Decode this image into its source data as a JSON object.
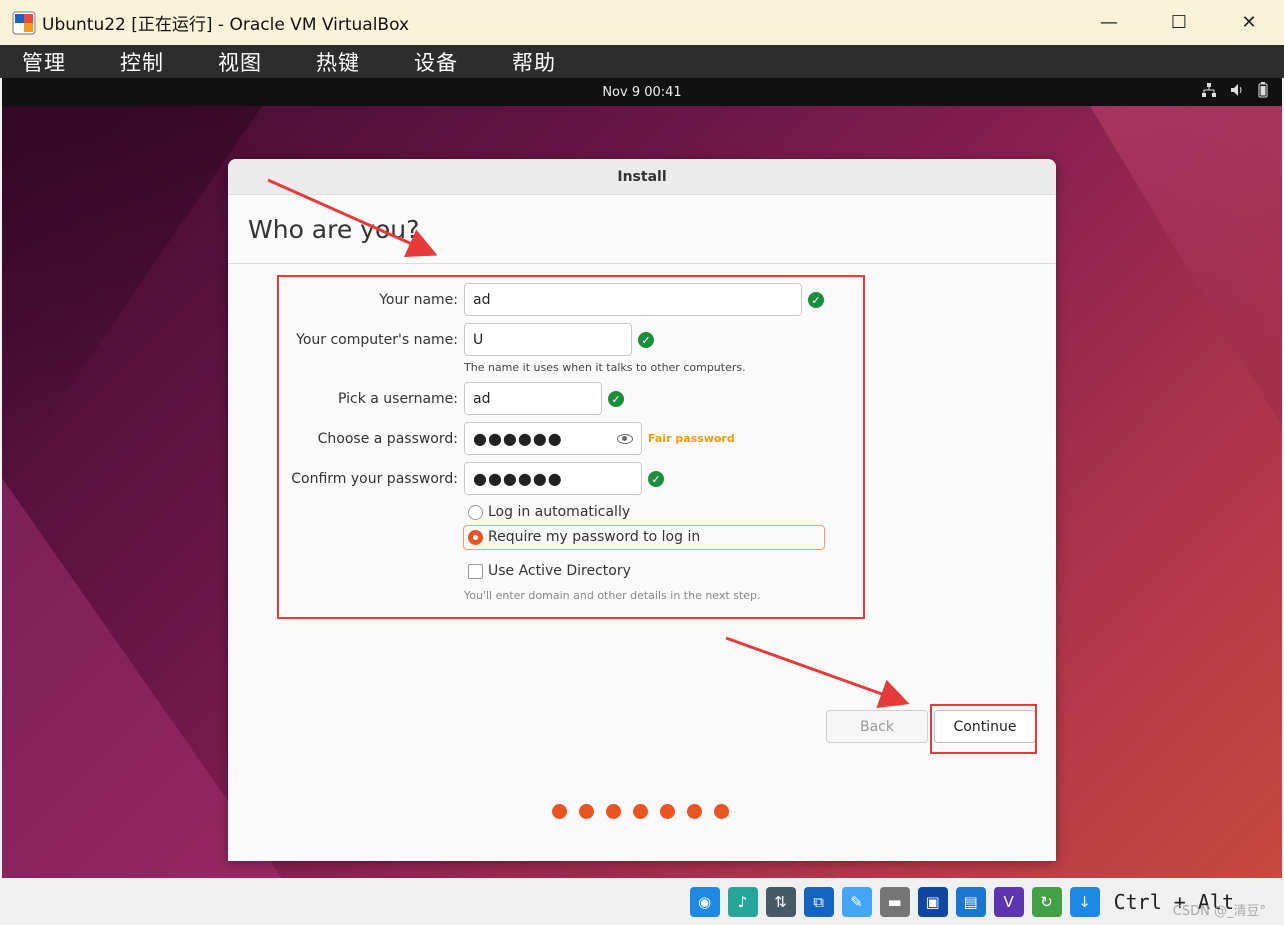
{
  "window": {
    "title": "Ubuntu22 [正在运行] - Oracle VM VirtualBox",
    "minimize": "—",
    "maximize": "☐",
    "close": "✕"
  },
  "menu": [
    "管理",
    "控制",
    "视图",
    "热键",
    "设备",
    "帮助"
  ],
  "guest_topbar": {
    "clock": "Nov 9  00:41"
  },
  "dialog": {
    "title": "Install",
    "heading": "Who are you?",
    "fields": {
      "name_label": "Your name:",
      "name_value": "ad",
      "computer_label": "Your computer's name:",
      "computer_value": "U",
      "computer_hint": "The name it uses when it talks to other computers.",
      "username_label": "Pick a username:",
      "username_value": "ad",
      "password_label": "Choose a password:",
      "password_value": "●●●●●●",
      "password_strength": "Fair password",
      "confirm_label": "Confirm your password:",
      "confirm_value": "●●●●●●"
    },
    "options": {
      "auto_login": "Log in automatically",
      "require_password": "Require my password to log in",
      "active_directory": "Use Active Directory",
      "ad_hint": "You'll enter domain and other details in the next step."
    },
    "buttons": {
      "back": "Back",
      "continue": "Continue"
    },
    "progress": {
      "current": 7,
      "total": 7
    }
  },
  "statusbar": {
    "hostkey": "Ctrl + Alt",
    "watermark": "CSDN @_清豆°"
  },
  "colors": {
    "accent": "#e95420",
    "ok": "#1b8e3c",
    "annotation": "#e53b3b",
    "strength": "#f29b14"
  }
}
